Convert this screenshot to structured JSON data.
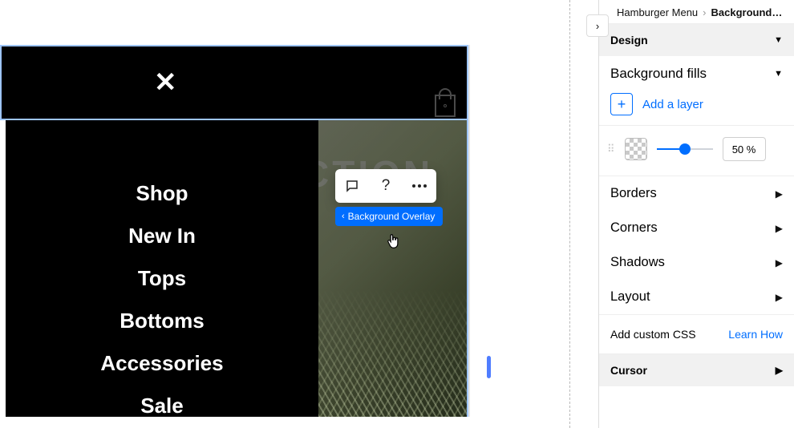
{
  "breadcrumb": {
    "parent": "Hamburger Menu",
    "current": "Background Ove..."
  },
  "panel": {
    "design_head": "Design",
    "bg_fills_title": "Background fills",
    "add_layer_label": "Add a layer",
    "opacity_value": "50 %",
    "sections": {
      "borders": "Borders",
      "corners": "Corners",
      "shadows": "Shadows",
      "layout": "Layout"
    },
    "custom_css_label": "Add custom CSS",
    "learn_how": "Learn How",
    "cursor_head": "Cursor"
  },
  "canvas": {
    "hero_text": "CTION",
    "nav_items": [
      "Shop",
      "New In",
      "Tops",
      "Bottoms",
      "Accessories",
      "Sale"
    ],
    "selection_label": "Background Overlay"
  }
}
